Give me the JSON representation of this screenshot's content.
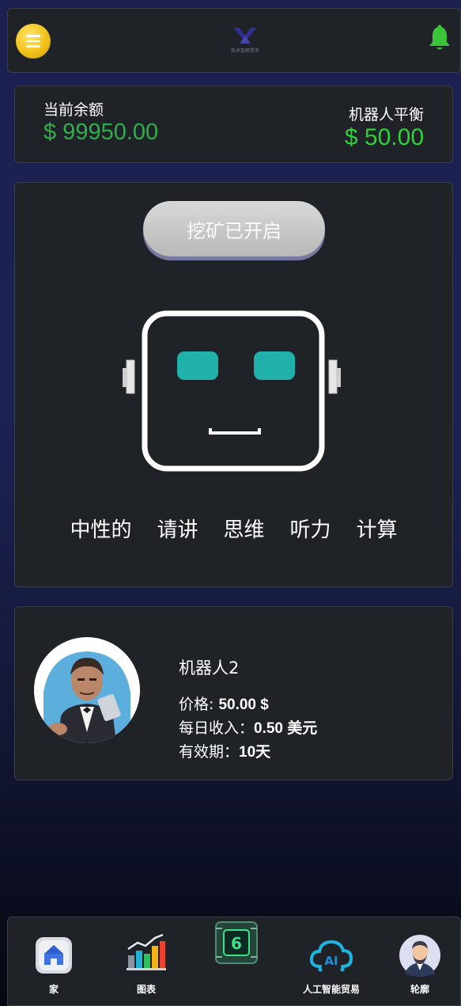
{
  "header": {
    "logo_text": "技术加密货币",
    "icons": {
      "menu": "menu-icon",
      "bell": "bell-icon"
    }
  },
  "balance": {
    "current_label": "当前余额",
    "current_value": "$ 99950.00",
    "robot_label": "机器人平衡",
    "robot_value": "$ 50.00"
  },
  "mining": {
    "button_label": "挖矿已开启",
    "words": [
      "中性的",
      "请讲",
      "思维",
      "听力",
      "计算"
    ]
  },
  "product": {
    "name": "机器人2",
    "price_label": "价格: ",
    "price_value": "50.00 $",
    "daily_label": "每日收入：",
    "daily_value": "0.50 美元",
    "validity_label": "有效期：",
    "validity_value": "10天"
  },
  "tabs": [
    {
      "label": "家",
      "icon": "home-icon"
    },
    {
      "label": "图表",
      "icon": "chart-icon"
    },
    {
      "label": "",
      "icon": "chip-icon"
    },
    {
      "label": "人工智能贸易",
      "icon": "ai-cloud-icon"
    },
    {
      "label": "轮廓",
      "icon": "profile-avatar-icon"
    }
  ],
  "colors": {
    "green_balance": "#2fb04a",
    "green_robot": "#2ed13a",
    "teal_eyes": "#20b2aa",
    "card_bg": "#1f2227"
  }
}
